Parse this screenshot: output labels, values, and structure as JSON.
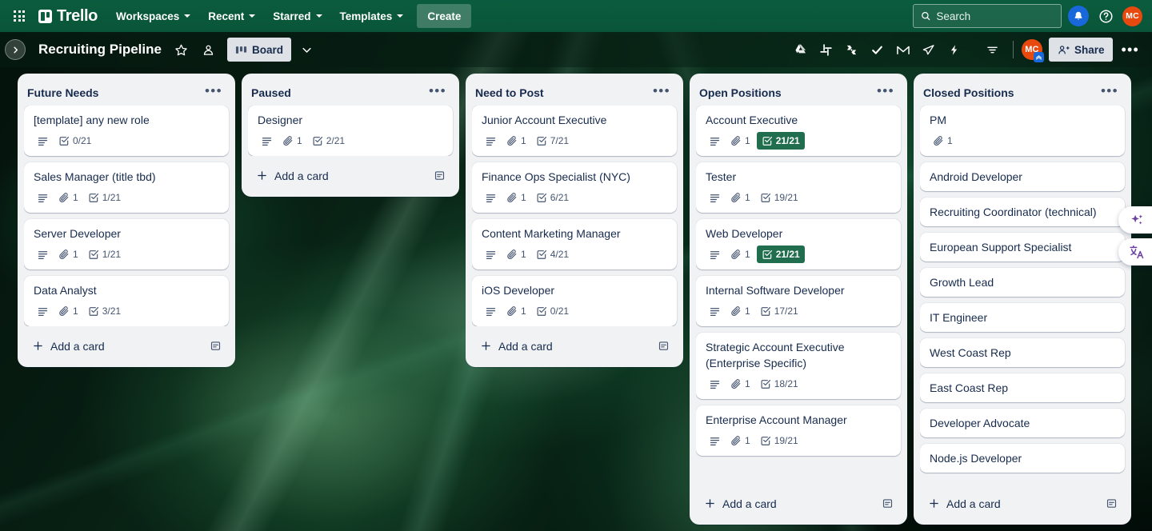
{
  "top_nav": {
    "apps_icon": "grid-apps-icon",
    "brand": "Trello",
    "items": [
      {
        "label": "Workspaces",
        "has_chevron": true
      },
      {
        "label": "Recent",
        "has_chevron": true
      },
      {
        "label": "Starred",
        "has_chevron": true
      },
      {
        "label": "Templates",
        "has_chevron": true
      }
    ],
    "create_label": "Create",
    "search": {
      "placeholder": "Search",
      "value": "",
      "icon": "search-icon"
    },
    "notifications_icon": "notification-bell-icon",
    "help_icon": "help-question-icon",
    "avatar_initials": "MC"
  },
  "board_header": {
    "sidebar_toggle_icon": "chevron-right-icon",
    "title": "Recruiting Pipeline",
    "star_icon": "star-outline-icon",
    "visibility_icon": "workspace-visible-icon",
    "view_label": "Board",
    "view_icon": "board-view-icon",
    "view_chevron_icon": "chevron-down-icon",
    "power_ups": [
      "google-drive-icon",
      "slack-icon",
      "jira-icon",
      "checkmark-icon",
      "gmail-icon",
      "telegram-icon",
      "automation-bolt-icon",
      "filter-icon"
    ],
    "member_initials": "MC",
    "member_badge_icon": "premium-badge-icon",
    "share_label": "Share",
    "share_icon": "person-add-icon",
    "menu_icon": "board-menu-ellipsis-icon"
  },
  "lists": [
    {
      "title": "Future Needs",
      "menu_icon": "list-menu-ellipsis-icon",
      "add_card_label": "Add a card",
      "add_card_icon": "plus-icon",
      "template_icon": "card-template-icon",
      "has_scrollbar": false,
      "cards": [
        {
          "title": "[template] any new role",
          "description_icon": "description-icon",
          "attachments": null,
          "checklist": "0/21",
          "checklist_complete": false
        },
        {
          "title": "Sales Manager (title tbd)",
          "description_icon": "description-icon",
          "attachments": "1",
          "checklist": "1/21",
          "checklist_complete": false
        },
        {
          "title": "Server Developer",
          "description_icon": "description-icon",
          "attachments": "1",
          "checklist": "1/21",
          "checklist_complete": false
        },
        {
          "title": "Data Analyst",
          "description_icon": "description-icon",
          "attachments": "1",
          "checklist": "3/21",
          "checklist_complete": false
        }
      ]
    },
    {
      "title": "Paused",
      "menu_icon": "list-menu-ellipsis-icon",
      "add_card_label": "Add a card",
      "add_card_icon": "plus-icon",
      "template_icon": "card-template-icon",
      "has_scrollbar": false,
      "cards": [
        {
          "title": "Designer",
          "description_icon": "description-icon",
          "attachments": "1",
          "checklist": "2/21",
          "checklist_complete": false
        }
      ]
    },
    {
      "title": "Need to Post",
      "menu_icon": "list-menu-ellipsis-icon",
      "add_card_label": "Add a card",
      "add_card_icon": "plus-icon",
      "template_icon": "card-template-icon",
      "has_scrollbar": false,
      "cards": [
        {
          "title": "Junior Account Executive",
          "description_icon": "description-icon",
          "attachments": "1",
          "checklist": "7/21",
          "checklist_complete": false
        },
        {
          "title": "Finance Ops Specialist (NYC)",
          "description_icon": "description-icon",
          "attachments": "1",
          "checklist": "6/21",
          "checklist_complete": false
        },
        {
          "title": "Content Marketing Manager",
          "description_icon": "description-icon",
          "attachments": "1",
          "checklist": "4/21",
          "checklist_complete": false
        },
        {
          "title": "iOS Developer",
          "description_icon": "description-icon",
          "attachments": "1",
          "checklist": "0/21",
          "checklist_complete": false
        }
      ]
    },
    {
      "title": "Open Positions",
      "menu_icon": "list-menu-ellipsis-icon",
      "add_card_label": "Add a card",
      "add_card_icon": "plus-icon",
      "template_icon": "card-template-icon",
      "has_scrollbar": true,
      "cards": [
        {
          "title": "Account Executive",
          "description_icon": "description-icon",
          "attachments": "1",
          "checklist": "21/21",
          "checklist_complete": true
        },
        {
          "title": "Tester",
          "description_icon": "description-icon",
          "attachments": "1",
          "checklist": "19/21",
          "checklist_complete": false
        },
        {
          "title": "Web Developer",
          "description_icon": "description-icon",
          "attachments": "1",
          "checklist": "21/21",
          "checklist_complete": true
        },
        {
          "title": "Internal Software Developer",
          "description_icon": "description-icon",
          "attachments": "1",
          "checklist": "17/21",
          "checklist_complete": false
        },
        {
          "title": "Strategic Account Executive (Enterprise Specific)",
          "description_icon": "description-icon",
          "attachments": "1",
          "checklist": "18/21",
          "checklist_complete": false
        },
        {
          "title": "Enterprise Account Manager",
          "description_icon": "description-icon",
          "attachments": "1",
          "checklist": "19/21",
          "checklist_complete": false
        }
      ]
    },
    {
      "title": "Closed Positions",
      "menu_icon": "list-menu-ellipsis-icon",
      "add_card_label": "Add a card",
      "add_card_icon": "plus-icon",
      "template_icon": "card-template-icon",
      "has_scrollbar": true,
      "cards": [
        {
          "title": "PM",
          "description_icon": null,
          "attachments": "1",
          "checklist": null,
          "checklist_complete": false
        },
        {
          "title": "Android Developer",
          "description_icon": null,
          "attachments": null,
          "checklist": null,
          "checklist_complete": false
        },
        {
          "title": "Recruiting Coordinator (technical)",
          "description_icon": null,
          "attachments": null,
          "checklist": null,
          "checklist_complete": false
        },
        {
          "title": "European Support Specialist",
          "description_icon": null,
          "attachments": null,
          "checklist": null,
          "checklist_complete": false
        },
        {
          "title": "Growth Lead",
          "description_icon": null,
          "attachments": null,
          "checklist": null,
          "checklist_complete": false
        },
        {
          "title": "IT Engineer",
          "description_icon": null,
          "attachments": null,
          "checklist": null,
          "checklist_complete": false
        },
        {
          "title": "West Coast Rep",
          "description_icon": null,
          "attachments": null,
          "checklist": null,
          "checklist_complete": false
        },
        {
          "title": "East Coast Rep",
          "description_icon": null,
          "attachments": null,
          "checklist": null,
          "checklist_complete": false
        },
        {
          "title": "Developer Advocate",
          "description_icon": null,
          "attachments": null,
          "checklist": null,
          "checklist_complete": false
        },
        {
          "title": "Node.js Developer",
          "description_icon": null,
          "attachments": null,
          "checklist": null,
          "checklist_complete": false
        }
      ]
    }
  ],
  "floating_buttons": [
    {
      "icon": "ai-sparkle-icon"
    },
    {
      "icon": "translate-icon"
    }
  ],
  "colors": {
    "nav_green": "#0c5e3f",
    "list_bg": "#f1f2f4",
    "card_bg": "#ffffff",
    "text_primary": "#172b4d",
    "text_muted": "#44546f",
    "badge_complete_green": "#216e4e",
    "notification_blue": "#1868db",
    "avatar_orange": "#e8490f"
  }
}
